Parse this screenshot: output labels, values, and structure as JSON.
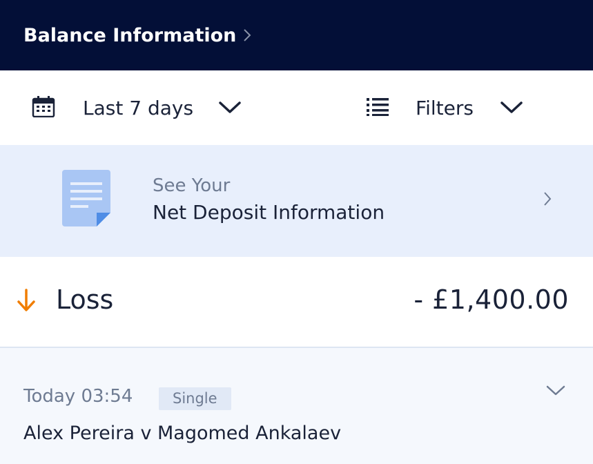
{
  "header": {
    "title": "Balance Information",
    "chevron_icon": "chevron-right-icon"
  },
  "filters": {
    "date_range": {
      "icon": "calendar-icon",
      "label": "Last 7 days",
      "dropdown_icon": "chevron-down-icon"
    },
    "filter": {
      "icon": "list-icon",
      "label": "Filters",
      "dropdown_icon": "chevron-down-icon"
    }
  },
  "banner": {
    "icon": "document-icon",
    "subtitle": "See Your",
    "title": "Net Deposit Information",
    "chevron_icon": "chevron-right-icon"
  },
  "summary": {
    "icon": "arrow-down-icon",
    "label": "Loss",
    "amount": "- £1,400.00"
  },
  "bets": [
    {
      "time": "Today 03:54",
      "type": "Single",
      "event": "Alex Pereira v Magomed Ankalaev",
      "expand_icon": "chevron-down-icon"
    }
  ],
  "colors": {
    "header_bg": "#030f37",
    "banner_bg": "#e8effc",
    "loss_arrow": "#f07d00",
    "text_primary": "#1a2238",
    "text_secondary": "#6e7b92",
    "bet_bg": "#f5f8fd"
  }
}
